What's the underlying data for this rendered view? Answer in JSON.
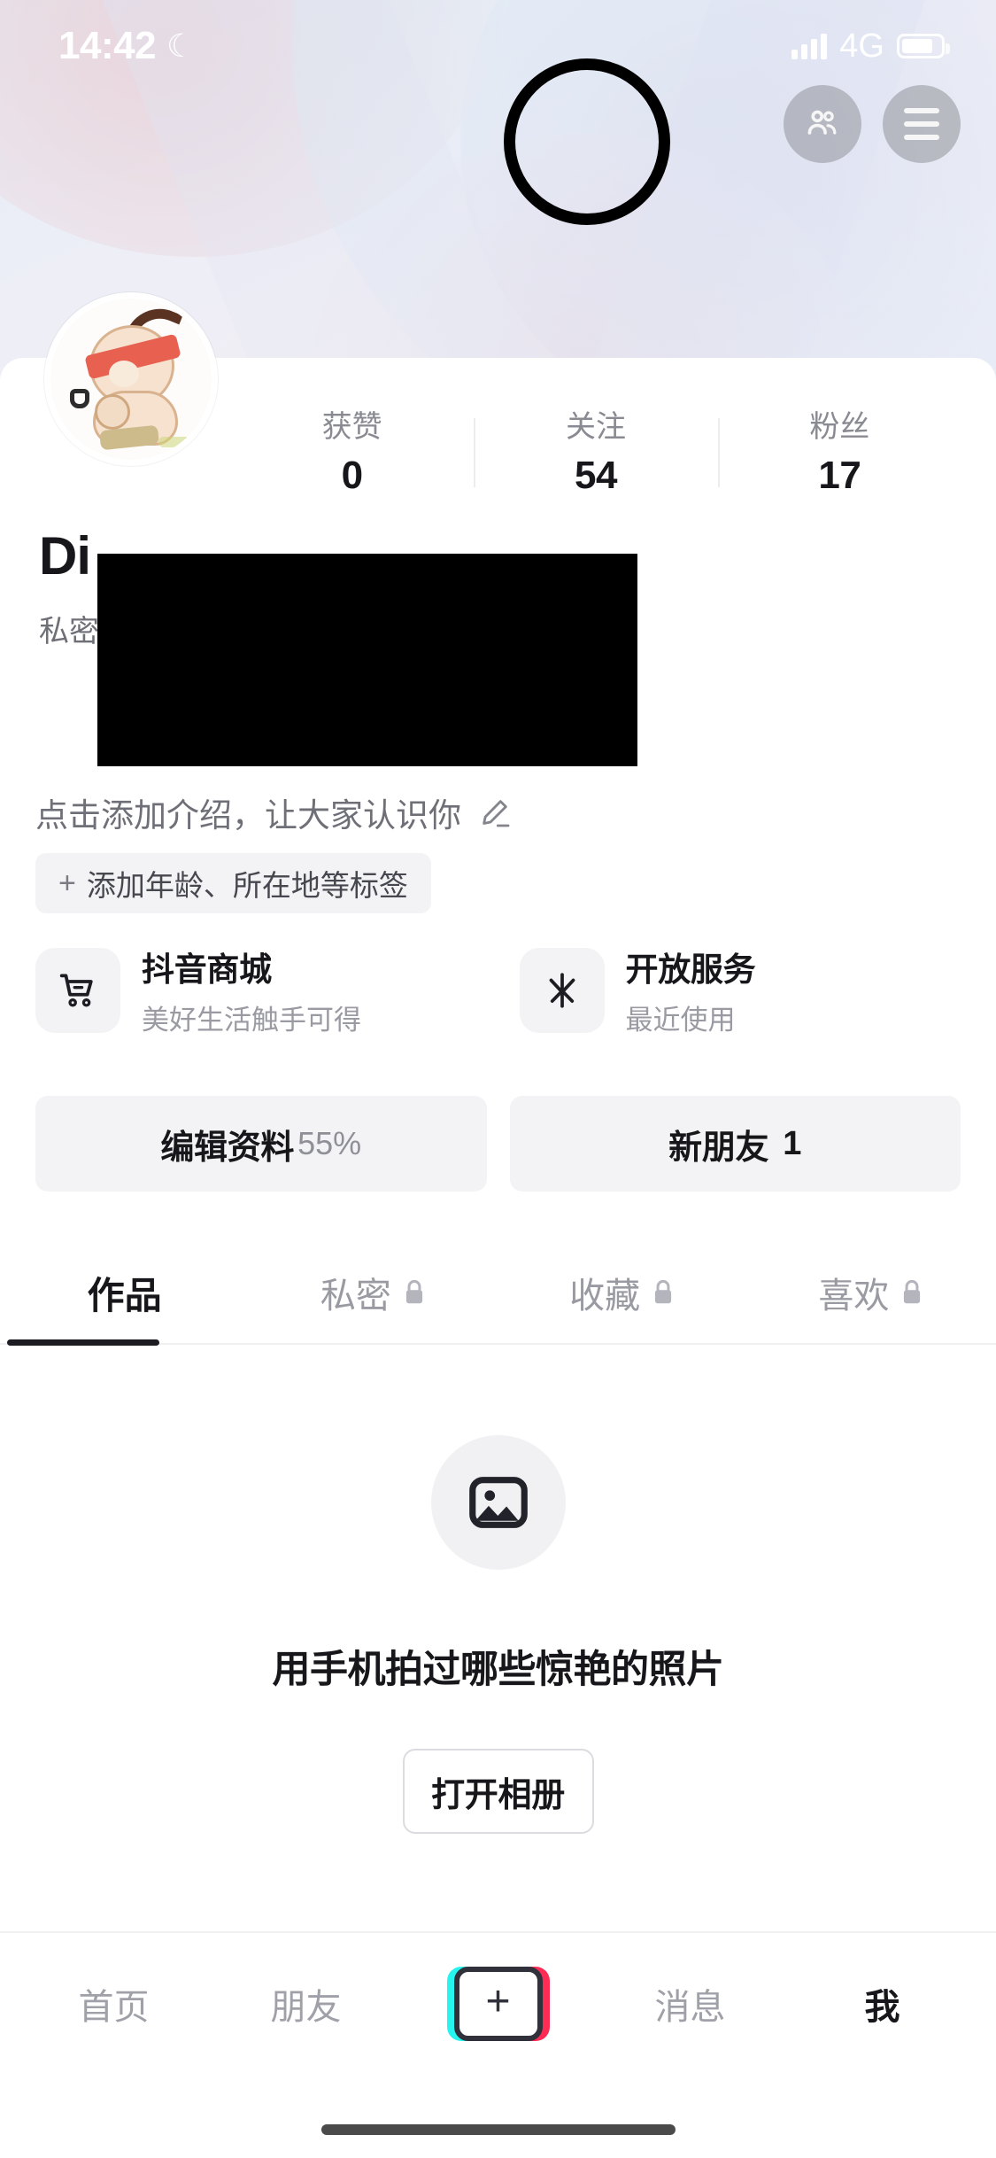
{
  "status_bar": {
    "time": "14:42",
    "dnd_icon": "crescent-moon-icon",
    "signal_icon": "signal-bars-icon",
    "network": "4G",
    "battery_icon": "battery-icon"
  },
  "header": {
    "add_friends_icon": "people-icon",
    "menu_icon": "hamburger-menu-icon",
    "annotation": "highlight-circle"
  },
  "profile": {
    "avatar_icon": "user-avatar-cartoon",
    "username": "Di",
    "privacy_label": "私密",
    "stats": [
      {
        "label": "获赞",
        "value": "0"
      },
      {
        "label": "关注",
        "value": "54"
      },
      {
        "label": "粉丝",
        "value": "17"
      }
    ],
    "bio_placeholder": "点击添加介绍，让大家认识你",
    "bio_edit_icon": "pencil-icon",
    "tag_button": {
      "plus": "+",
      "label": "添加年龄、所在地等标签"
    }
  },
  "services": [
    {
      "icon": "shopping-cart-icon",
      "title": "抖音商城",
      "subtitle": "美好生活触手可得"
    },
    {
      "icon": "douyin-asterisk-icon",
      "title": "开放服务",
      "subtitle": "最近使用"
    }
  ],
  "actions": [
    {
      "label": "编辑资料",
      "suffix": "55%"
    },
    {
      "label": "新朋友",
      "count": "1"
    }
  ],
  "tabs": [
    {
      "label": "作品",
      "locked": false,
      "active": true
    },
    {
      "label": "私密",
      "locked": true,
      "active": false,
      "lock_icon": "lock-icon"
    },
    {
      "label": "收藏",
      "locked": true,
      "active": false,
      "lock_icon": "lock-icon"
    },
    {
      "label": "喜欢",
      "locked": true,
      "active": false,
      "lock_icon": "lock-icon"
    }
  ],
  "empty_state": {
    "icon": "photo-image-icon",
    "title": "用手机拍过哪些惊艳的照片",
    "button_label": "打开相册"
  },
  "bottom_nav": {
    "items": [
      {
        "label": "首页",
        "active": false
      },
      {
        "label": "朋友",
        "active": false
      },
      {
        "label": "我",
        "active": true
      }
    ],
    "create_label": "+",
    "messages_label": "消息",
    "create_icon": "plus-create-icon"
  },
  "colors": {
    "accent_cyan": "#26f4ee",
    "accent_pink": "#fe2c55",
    "text_primary": "#17171b",
    "text_secondary": "#9a9aa2",
    "surface": "#f3f3f5",
    "annotation": "#000000"
  }
}
